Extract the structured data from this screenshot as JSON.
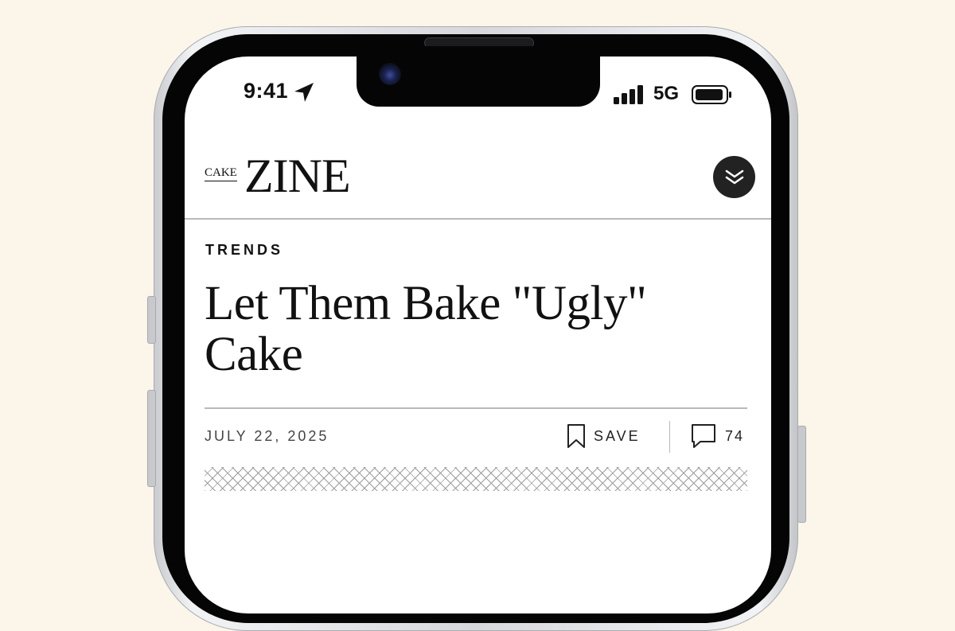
{
  "status_bar": {
    "time": "9:41",
    "network": "5G"
  },
  "masthead": {
    "logo_small": "CAKE",
    "logo_big": "ZINE"
  },
  "article": {
    "kicker": "TRENDS",
    "headline": "Let Them Bake \"Ugly\" Cake",
    "date": "JULY 22, 2025",
    "save_label": "SAVE",
    "comment_count": "74"
  },
  "icons": {
    "location": "location-arrow-icon",
    "signal": "cellular-signal-icon",
    "battery": "battery-icon",
    "menu": "double-chevron-down-icon",
    "save": "bookmark-icon",
    "comments": "speech-bubble-icon"
  },
  "colors": {
    "background": "#fbf5ea",
    "ink": "#111111",
    "menu_button": "#222222"
  }
}
